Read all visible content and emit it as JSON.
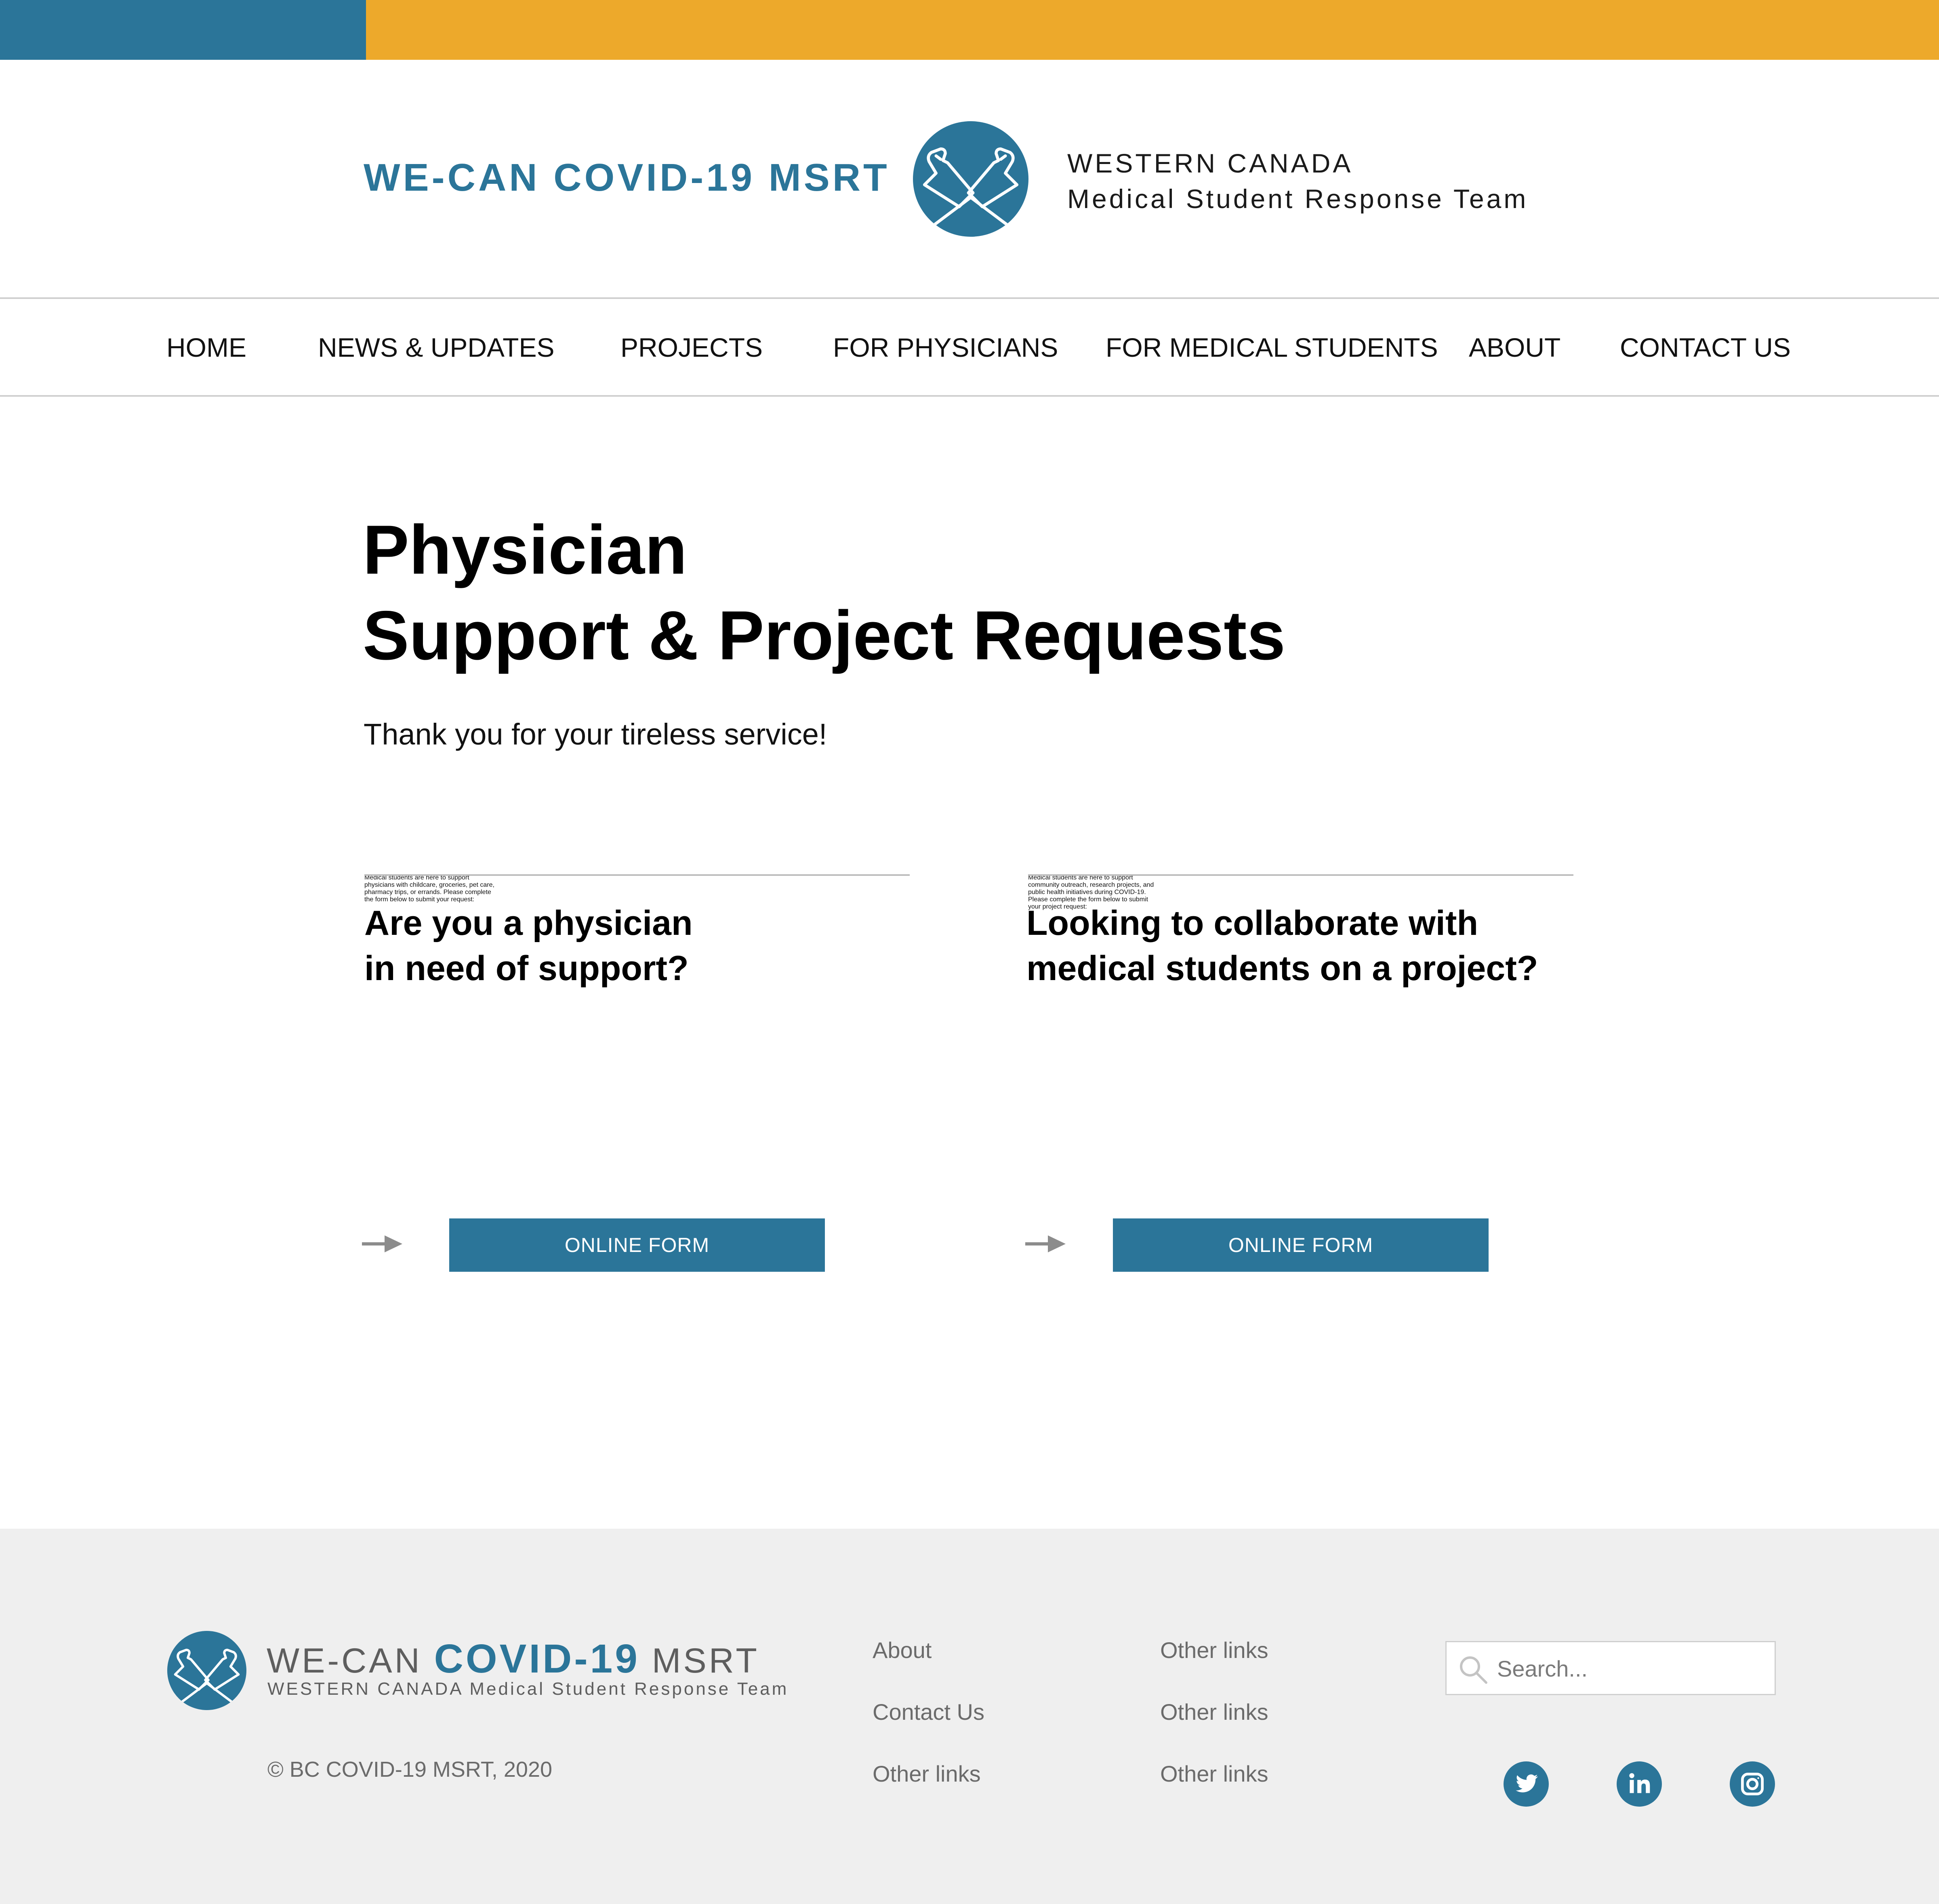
{
  "colors": {
    "brand_blue": "#2b7599",
    "brand_gold": "#eda92b",
    "footer_bg": "#efefef"
  },
  "header": {
    "title": "WE-CAN COVID-19 MSRT",
    "logo_icon": "crossed-arms-logo-icon",
    "subtitle_line1": "WESTERN CANADA",
    "subtitle_line2": "Medical Student Response Team"
  },
  "nav": {
    "items": [
      {
        "label": "HOME"
      },
      {
        "label": "NEWS & UPDATES"
      },
      {
        "label": "PROJECTS"
      },
      {
        "label": "FOR PHYSICIANS"
      },
      {
        "label": "FOR MEDICAL STUDENTS"
      },
      {
        "label": "ABOUT"
      },
      {
        "label": "CONTACT US"
      }
    ]
  },
  "main": {
    "title_line1": "Physician",
    "title_line2": "Support & Project Requests",
    "tagline": "Thank you for your tireless service!",
    "cards": [
      {
        "heading_line1": "Are you a physician",
        "heading_line2": "in need of support?",
        "body_lines": [
          "Medical students are here to support",
          "physicians with childcare, groceries, pet care,",
          "pharmacy trips, or errands. Please complete",
          "the form below to submit your request:"
        ],
        "arrow_icon": "right-arrow-icon",
        "button_label": "ONLINE FORM"
      },
      {
        "heading_line1": "Looking to collaborate with",
        "heading_line2": "medical students on a project?",
        "body_lines": [
          "Medical students are here to support",
          "community outreach, research projects, and",
          "public health initiatives during COVID-19.",
          "Please complete the form below to submit",
          "your project request:"
        ],
        "arrow_icon": "right-arrow-icon",
        "button_label": "ONLINE FORM"
      }
    ]
  },
  "footer": {
    "brand_prefix": "WE-CAN ",
    "brand_strong": "COVID-19",
    "brand_suffix": " MSRT",
    "brand_sub": "WESTERN CANADA Medical Student Response Team",
    "copyright": "© BC COVID-19 MSRT, 2020",
    "links_col1": [
      "About",
      "Contact Us",
      "Other links"
    ],
    "links_col2": [
      "Other links",
      "Other links",
      "Other links"
    ],
    "search": {
      "placeholder": "Search...",
      "value": "",
      "icon": "search-icon"
    },
    "social": [
      {
        "icon": "twitter-icon"
      },
      {
        "icon": "linkedin-icon"
      },
      {
        "icon": "instagram-icon"
      }
    ]
  }
}
